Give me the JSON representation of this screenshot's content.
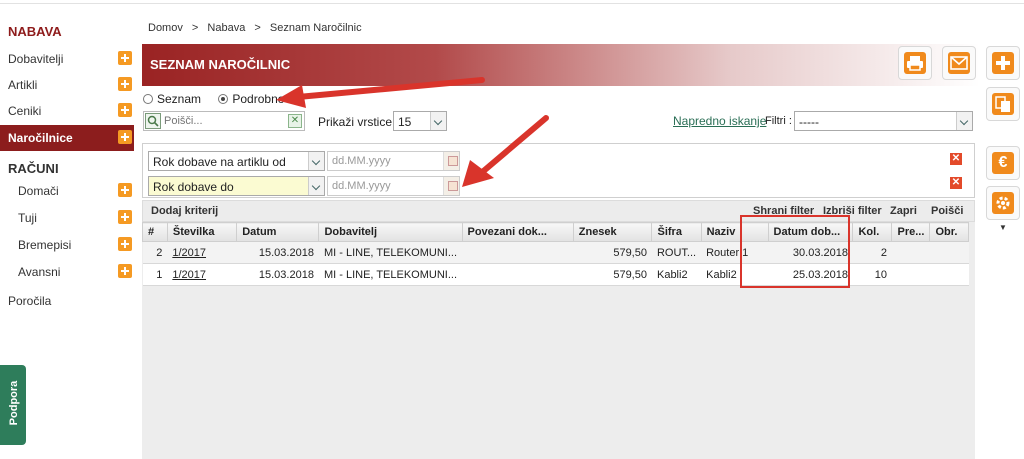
{
  "sidebar": {
    "sec1": "NABAVA",
    "items1": [
      {
        "label": "Dobavitelji"
      },
      {
        "label": "Artikli"
      },
      {
        "label": "Ceniki"
      },
      {
        "label": "Naročilnice"
      }
    ],
    "sec2": "RAČUNI",
    "items2": [
      {
        "label": "Domači"
      },
      {
        "label": "Tuji"
      },
      {
        "label": "Bremepisi"
      },
      {
        "label": "Avansni"
      }
    ],
    "reports": "Poročila",
    "support": "Podpora"
  },
  "breadcrumb": [
    "Domov",
    ">",
    "Nabava",
    ">",
    "Seznam Naročilnic"
  ],
  "page_title": "SEZNAM NAROČILNIC",
  "view": {
    "list": "Seznam",
    "detail": "Podrobno",
    "selected": "Podrobno"
  },
  "search": {
    "placeholder": "Poišči..."
  },
  "rows_label": "Prikaži vrstice:",
  "rows_value": "15",
  "advanced_search": "Napredno iskanje",
  "filters_label": "Filtri :",
  "filters_value": "-----",
  "criteria": [
    {
      "field": "Rok dobave na artiklu od",
      "placeholder": "dd.MM.yyyy"
    },
    {
      "field": "Rok dobave do",
      "placeholder": "dd.MM.yyyy"
    }
  ],
  "actions": {
    "add": "Dodaj kriterij",
    "save": "Shrani filter",
    "delete": "Izbriši filter",
    "close": "Zapri",
    "search": "Poišči"
  },
  "table": {
    "headers": [
      "#",
      "Številka",
      "Datum",
      "Dobavitelj",
      "Povezani dok...",
      "Znesek",
      "Šifra",
      "Naziv",
      "Datum dob...",
      "Kol.",
      "Pre...",
      "Obr."
    ],
    "rows": [
      [
        "2",
        "1/2017",
        "15.03.2018",
        "MI - LINE, TELEKOMUNI...",
        "",
        "579,50",
        "ROUT...",
        "Router 1",
        "30.03.2018",
        "2",
        "",
        ""
      ],
      [
        "1",
        "1/2017",
        "15.03.2018",
        "MI - LINE, TELEKOMUNI...",
        "",
        "579,50",
        "Kabli2",
        "Kabli2",
        "25.03.2018",
        "10",
        "",
        ""
      ]
    ]
  },
  "colors": {
    "brand": "#8c1d1d",
    "accent": "#f08a1c",
    "highlight": "#d9342b"
  }
}
